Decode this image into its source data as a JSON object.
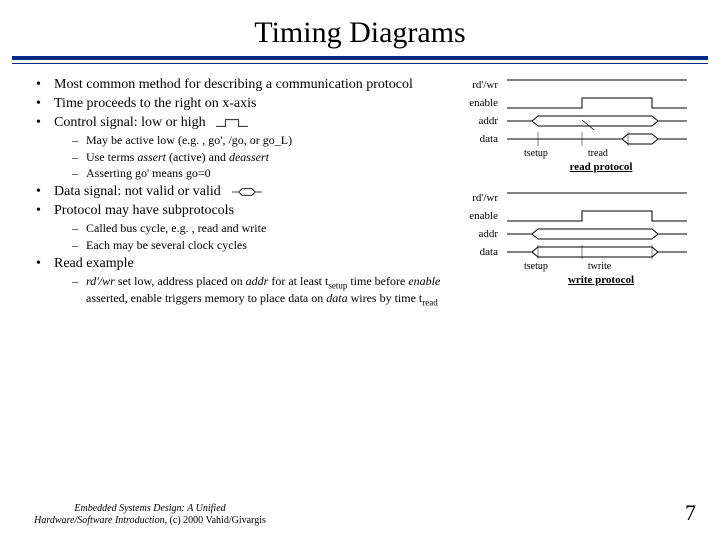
{
  "title": "Timing Diagrams",
  "bullets": {
    "b1": "Most common method for describing a communication protocol",
    "b2": "Time proceeds to the right on x-axis",
    "b3": "Control signal: low or high",
    "b3a": "May be active low (e.g. , go', /go, or go_L)",
    "b3b_pre": "Use terms ",
    "b3b_assert": "assert",
    "b3b_mid": " (active) and ",
    "b3b_deassert": "deassert",
    "b3c": "Asserting go' means go=0",
    "b4": "Data signal: not valid or valid",
    "b5": "Protocol may have subprotocols",
    "b5a": "Called bus cycle, e.g. , read and write",
    "b5b": "Each may be several clock cycles",
    "b6": "Read example",
    "b6a_1": "rd'/wr",
    "b6a_2": " set low, address placed on ",
    "b6a_3": "addr",
    "b6a_4": " for at least t",
    "b6a_5": "setup",
    "b6a_6": " time before ",
    "b6a_7": "enable",
    "b6a_8": " asserted, enable triggers memory to place data on ",
    "b6a_9": "data",
    "b6a_10": " wires by time t",
    "b6a_11": "read"
  },
  "diagram1": {
    "labels": {
      "rdwr": "rd'/wr",
      "enable": "enable",
      "addr": "addr",
      "data": "data"
    },
    "timing": {
      "tsetup": "tsetup",
      "tread": "tread"
    },
    "caption": "read protocol"
  },
  "diagram2": {
    "labels": {
      "rdwr": "rd'/wr",
      "enable": "enable",
      "addr": "addr",
      "data": "data"
    },
    "timing": {
      "tsetup": "tsetup",
      "twrite": "twrite"
    },
    "caption": "write protocol"
  },
  "footer": {
    "line1": "Embedded Systems Design: A Unified",
    "line2": "Hardware/Software Introduction, ",
    "copyright": "(c) 2000 Vahid/Givargis"
  },
  "page_number": "7"
}
